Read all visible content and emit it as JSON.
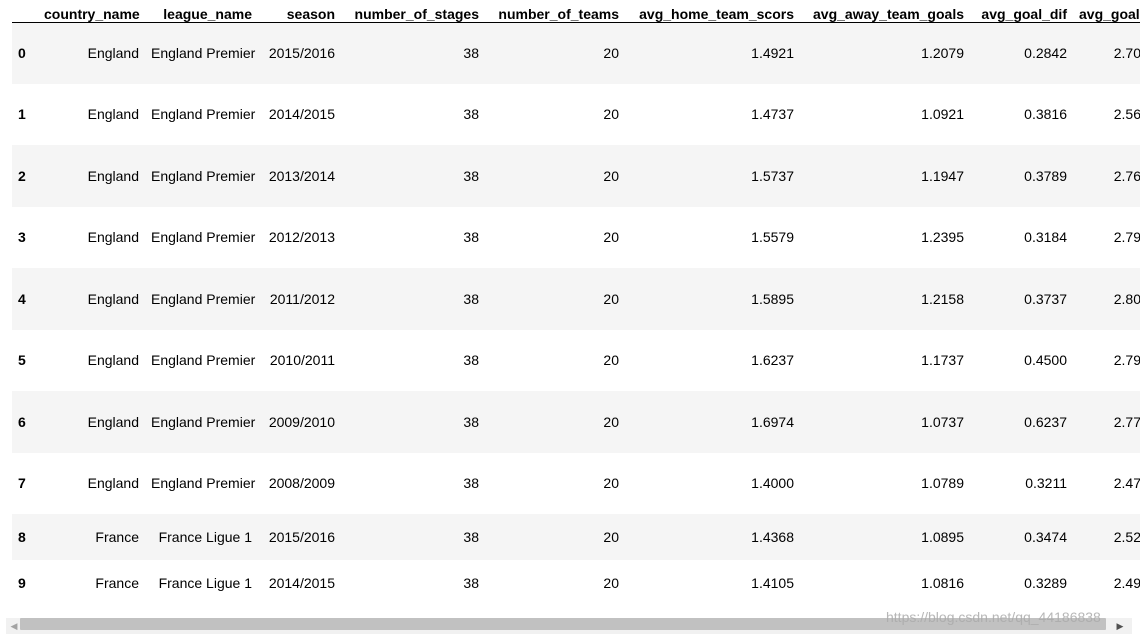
{
  "columns": [
    "",
    "country_name",
    "league_name",
    "season",
    "number_of_stages",
    "number_of_teams",
    "avg_home_team_scors",
    "avg_away_team_goals",
    "avg_goal_dif",
    "avg_goals"
  ],
  "rows": [
    {
      "index": "0",
      "country_name": "England",
      "league_name": "England Premier League",
      "season": "2015/2016",
      "number_of_stages": "38",
      "number_of_teams": "20",
      "avg_home_team_scors": "1.4921",
      "avg_away_team_goals": "1.2079",
      "avg_goal_dif": "0.2842",
      "avg_goals": "2.70"
    },
    {
      "index": "1",
      "country_name": "England",
      "league_name": "England Premier League",
      "season": "2014/2015",
      "number_of_stages": "38",
      "number_of_teams": "20",
      "avg_home_team_scors": "1.4737",
      "avg_away_team_goals": "1.0921",
      "avg_goal_dif": "0.3816",
      "avg_goals": "2.56"
    },
    {
      "index": "2",
      "country_name": "England",
      "league_name": "England Premier League",
      "season": "2013/2014",
      "number_of_stages": "38",
      "number_of_teams": "20",
      "avg_home_team_scors": "1.5737",
      "avg_away_team_goals": "1.1947",
      "avg_goal_dif": "0.3789",
      "avg_goals": "2.76"
    },
    {
      "index": "3",
      "country_name": "England",
      "league_name": "England Premier League",
      "season": "2012/2013",
      "number_of_stages": "38",
      "number_of_teams": "20",
      "avg_home_team_scors": "1.5579",
      "avg_away_team_goals": "1.2395",
      "avg_goal_dif": "0.3184",
      "avg_goals": "2.79"
    },
    {
      "index": "4",
      "country_name": "England",
      "league_name": "England Premier League",
      "season": "2011/2012",
      "number_of_stages": "38",
      "number_of_teams": "20",
      "avg_home_team_scors": "1.5895",
      "avg_away_team_goals": "1.2158",
      "avg_goal_dif": "0.3737",
      "avg_goals": "2.80"
    },
    {
      "index": "5",
      "country_name": "England",
      "league_name": "England Premier League",
      "season": "2010/2011",
      "number_of_stages": "38",
      "number_of_teams": "20",
      "avg_home_team_scors": "1.6237",
      "avg_away_team_goals": "1.1737",
      "avg_goal_dif": "0.4500",
      "avg_goals": "2.79"
    },
    {
      "index": "6",
      "country_name": "England",
      "league_name": "England Premier League",
      "season": "2009/2010",
      "number_of_stages": "38",
      "number_of_teams": "20",
      "avg_home_team_scors": "1.6974",
      "avg_away_team_goals": "1.0737",
      "avg_goal_dif": "0.6237",
      "avg_goals": "2.77"
    },
    {
      "index": "7",
      "country_name": "England",
      "league_name": "England Premier League",
      "season": "2008/2009",
      "number_of_stages": "38",
      "number_of_teams": "20",
      "avg_home_team_scors": "1.4000",
      "avg_away_team_goals": "1.0789",
      "avg_goal_dif": "0.3211",
      "avg_goals": "2.47"
    },
    {
      "index": "8",
      "country_name": "France",
      "league_name": "France Ligue 1",
      "season": "2015/2016",
      "number_of_stages": "38",
      "number_of_teams": "20",
      "avg_home_team_scors": "1.4368",
      "avg_away_team_goals": "1.0895",
      "avg_goal_dif": "0.3474",
      "avg_goals": "2.52"
    },
    {
      "index": "9",
      "country_name": "France",
      "league_name": "France Ligue 1",
      "season": "2014/2015",
      "number_of_stages": "38",
      "number_of_teams": "20",
      "avg_home_team_scors": "1.4105",
      "avg_away_team_goals": "1.0816",
      "avg_goal_dif": "0.3289",
      "avg_goals": "2.49"
    }
  ],
  "scrollbar": {
    "left_arrow_icon": "triangle-left",
    "right_arrow_icon": "triangle-right",
    "left_arrow_glyph": "◀",
    "right_arrow_glyph": "▶"
  },
  "watermark": "https://blog.csdn.net/qq_44186838",
  "colors": {
    "row_odd": "#f5f5f5",
    "row_even": "#ffffff",
    "scroll_thumb": "#c1c1c1",
    "scroll_track": "#f1f1f1"
  }
}
